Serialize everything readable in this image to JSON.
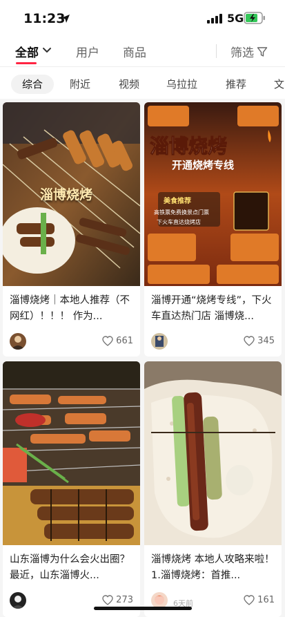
{
  "status": {
    "time": "11:23",
    "network": "5G"
  },
  "tabs": {
    "all": "全部",
    "users": "用户",
    "goods": "商品",
    "filter": "筛选"
  },
  "chips": [
    "综合",
    "附近",
    "视频",
    "乌拉拉",
    "推荐",
    "文"
  ],
  "cards": [
    {
      "title": "淄博烧烤｜本地人推荐（不网红）！！！ 作为...",
      "likes": "661",
      "image_text": [
        "淄博烧烤"
      ]
    },
    {
      "title": "淄博开通“烧烤专线”，下火车直达热门店 淄博烧...",
      "likes": "345",
      "image_text": [
        "淄博烧烤",
        "开通烧烤专线",
        "美食推荐",
        "高铁票免费换景点门票",
        "下火车直达烧烤店"
      ]
    },
    {
      "title": "山东淄博为什么会火出圈？ 最近，山东淄博火...",
      "likes": "273",
      "image_text": []
    },
    {
      "title": "淄博烧烤 本地人攻略来啦！ 1.淄博烧烤：首推...",
      "likes": "161",
      "meta": "6天前",
      "image_text": []
    }
  ],
  "colors": {
    "accent": "#ff2442",
    "like": "#666666"
  },
  "icons": [
    "location-arrow-icon",
    "signal-icon",
    "battery-charging-icon",
    "chevron-down-icon",
    "filter-funnel-icon",
    "heart-outline-icon"
  ]
}
